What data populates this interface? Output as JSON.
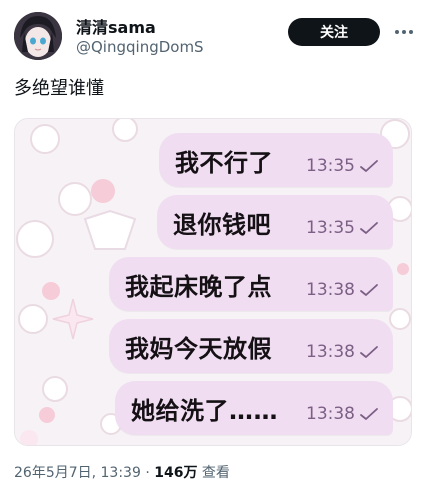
{
  "author": {
    "display_name": "清清sama",
    "handle": "@QingqingDomS"
  },
  "follow_label": "关注",
  "post_text": "多绝望谁懂",
  "chat": {
    "messages": [
      {
        "text": "我不行了",
        "time": "13:35"
      },
      {
        "text": "退你钱吧",
        "time": "13:35"
      },
      {
        "text": "我起床晚了点",
        "time": "13:38"
      },
      {
        "text": "我妈今天放假",
        "time": "13:38"
      },
      {
        "text": "她给洗了……",
        "time": "13:38"
      }
    ]
  },
  "footer": {
    "date": "26年5月7日, 13:39",
    "separator": "·",
    "views": "146万",
    "views_label": "查看"
  },
  "colors": {
    "bubble": "#f0ddf2",
    "follow_button": "#0f1419",
    "secondary_text": "#536471"
  },
  "icons": [
    "avatar",
    "more-icon",
    "check-icon"
  ]
}
